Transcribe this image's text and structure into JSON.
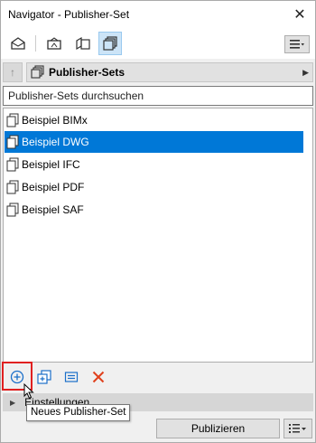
{
  "window": {
    "title": "Navigator - Publisher-Set",
    "close_glyph": "✕"
  },
  "toolbar": {
    "buttons": [
      {
        "icon": "project-map-icon",
        "active": false
      },
      {
        "icon": "view-map-icon",
        "active": false
      },
      {
        "icon": "layout-book-icon",
        "active": false
      },
      {
        "icon": "publisher-sets-icon",
        "active": true
      }
    ],
    "menu_icon": "hamburger-menu-icon"
  },
  "path": {
    "up_glyph": "↑",
    "current": "Publisher-Sets",
    "arrow_glyph": "▶"
  },
  "search": {
    "placeholder": "Publisher-Sets durchsuchen",
    "value": ""
  },
  "list": {
    "items": [
      {
        "label": "Beispiel BIMx",
        "selected": false
      },
      {
        "label": "Beispiel DWG",
        "selected": true
      },
      {
        "label": "Beispiel IFC",
        "selected": false
      },
      {
        "label": "Beispiel PDF",
        "selected": false
      },
      {
        "label": "Beispiel SAF",
        "selected": false
      }
    ]
  },
  "bottom_tools": {
    "add": "add-publisher-set-icon",
    "clone": "clone-set-icon",
    "settings": "set-settings-icon",
    "delete": "delete-icon"
  },
  "settings_panel": {
    "label": "Einstellungen",
    "arrow_glyph": "▶"
  },
  "tooltip": {
    "text": "Neues Publisher-Set"
  },
  "footer": {
    "publish_label": "Publizieren"
  },
  "colors": {
    "selection": "#0078d7",
    "active_toggle": "#cce4f7",
    "highlight": "#e02020",
    "delete": "#e0401c",
    "add_icon": "#1a6fc9"
  }
}
